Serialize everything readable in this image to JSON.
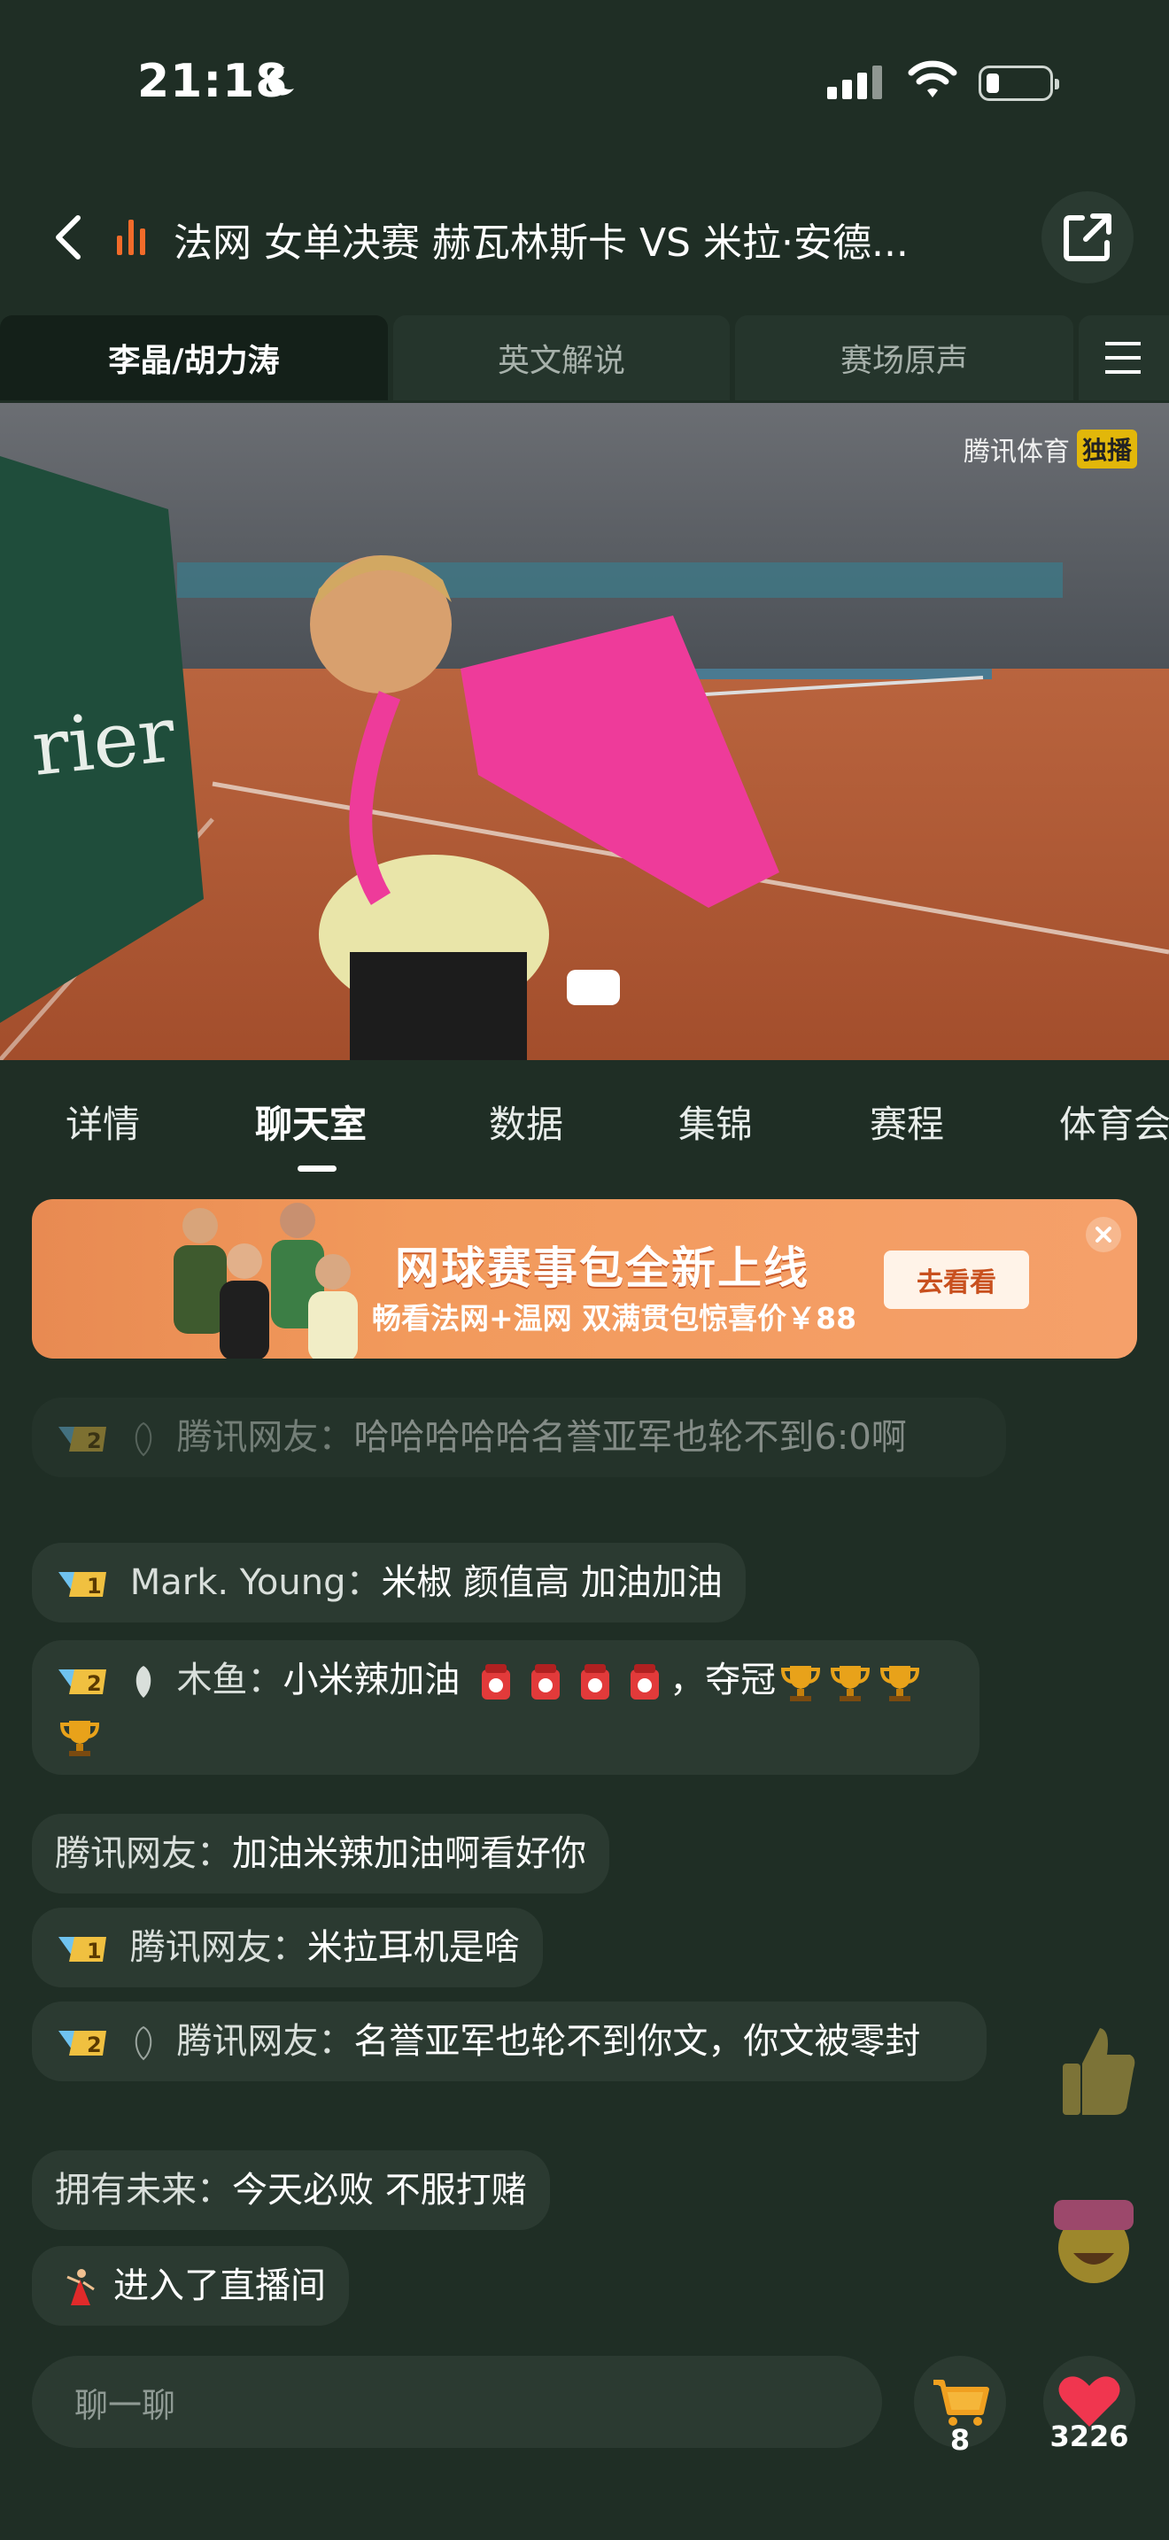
{
  "status_bar": {
    "time": "21:18"
  },
  "header": {
    "title": "法网 女单决赛  赫瓦林斯卡 VS 米拉·安德..."
  },
  "commentary_tabs": [
    {
      "label": "李晶/胡力涛",
      "active": true
    },
    {
      "label": "英文解说",
      "active": false
    },
    {
      "label": "赛场原声",
      "active": false
    }
  ],
  "video": {
    "watermark": "腾讯体育",
    "watermark_badge": "独播"
  },
  "main_tabs": [
    {
      "label": "详情"
    },
    {
      "label": "聊天室",
      "active": true
    },
    {
      "label": "数据"
    },
    {
      "label": "集锦"
    },
    {
      "label": "赛程"
    },
    {
      "label": "体育会"
    }
  ],
  "banner": {
    "title": "网球赛事包全新上线",
    "subtitle": "畅看法网+温网 双满贯包惊喜价￥88",
    "button": "去看看"
  },
  "chat": [
    {
      "nick": "腾讯网友：",
      "text": "哈哈哈哈哈名誉亚军也轮不到6:0啊",
      "badge": "2",
      "faded": true
    },
    {
      "nick": "Mark. Young：",
      "text": "米椒 颜值高  加油加油",
      "badge": "1"
    },
    {
      "nick": "木鱼：",
      "text": "小米辣加油",
      "text2": "，夺冠",
      "badge": "2"
    },
    {
      "nick": "腾讯网友：",
      "text": "加油米辣加油啊看好你"
    },
    {
      "nick": "腾讯网友：",
      "text": "米拉耳机是啥",
      "badge": "1"
    },
    {
      "nick": "腾讯网友：",
      "text": "名誉亚军也轮不到你文，你文被零封",
      "badge": "2"
    },
    {
      "nick": "拥有未来：",
      "text": "今天必败 不服打赌"
    },
    {
      "text": "进入了直播间"
    }
  ],
  "bottom_bar": {
    "input_placeholder": "聊一聊",
    "cart_count": "8",
    "like_count": "3226"
  },
  "colors": {
    "background": "#1f2e25",
    "live_accent": "#f26b2a",
    "banner": "#f29a5c",
    "like": "#f0364f"
  }
}
